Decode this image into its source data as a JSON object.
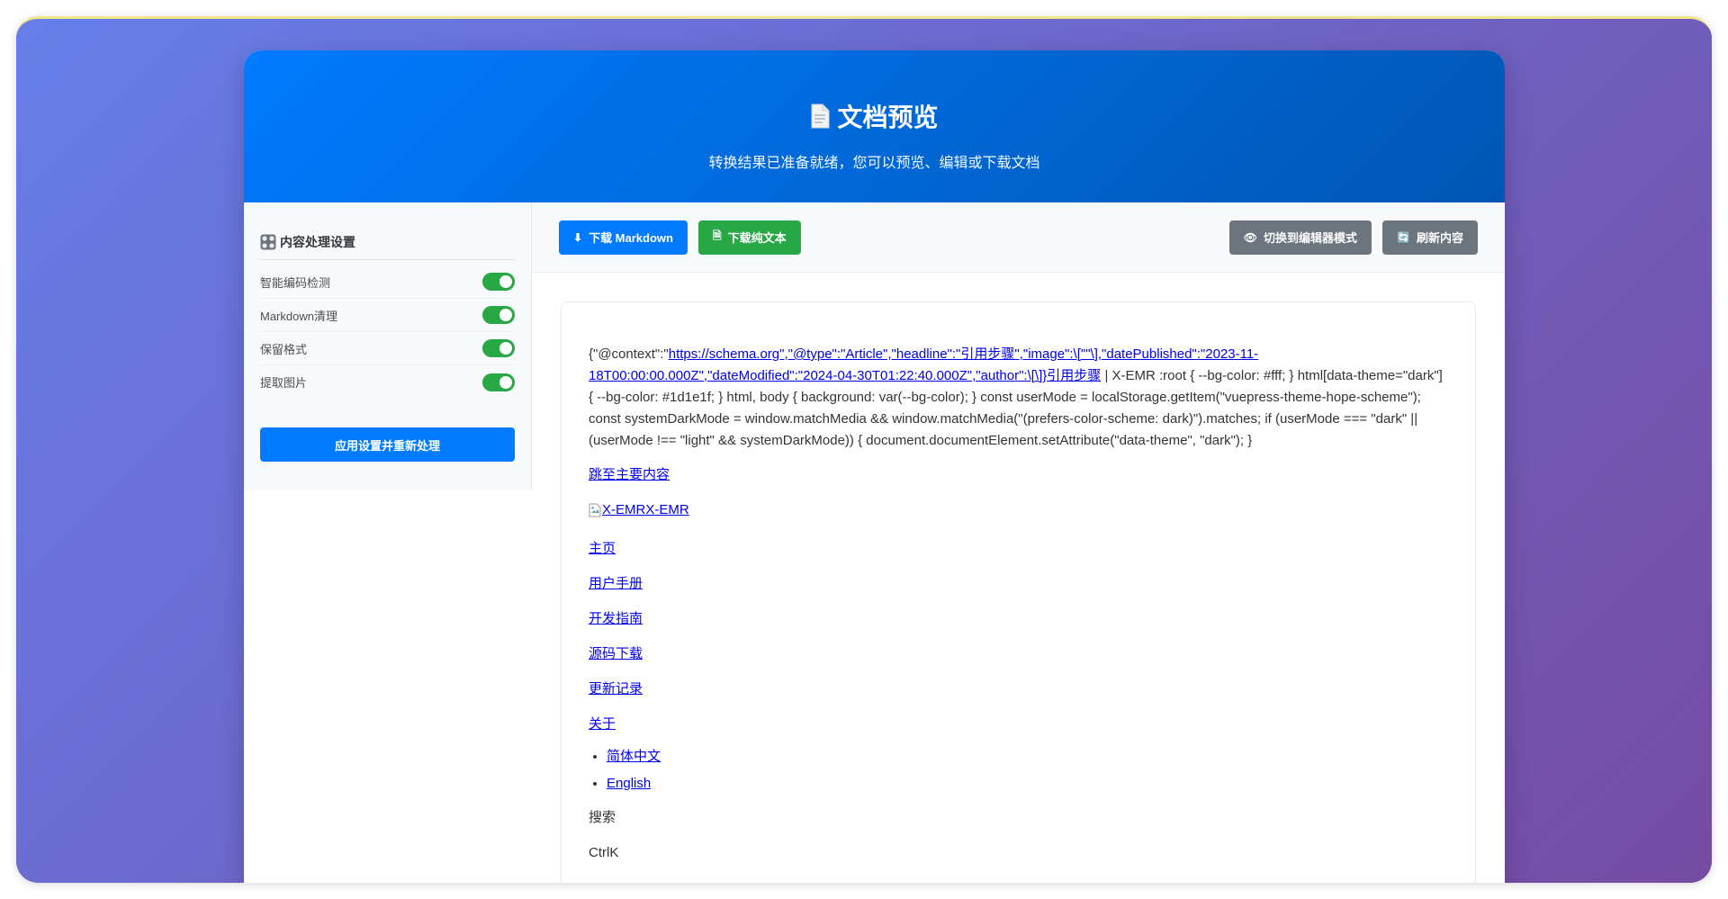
{
  "header": {
    "title": "文档预览",
    "subtitle": "转换结果已准备就绪，您可以预览、编辑或下载文档"
  },
  "sidebar": {
    "title": "内容处理设置",
    "settings": [
      {
        "label": "智能编码检测",
        "enabled": true
      },
      {
        "label": "Markdown清理",
        "enabled": true
      },
      {
        "label": "保留格式",
        "enabled": true
      },
      {
        "label": "提取图片",
        "enabled": true
      }
    ],
    "apply_label": "应用设置并重新处理"
  },
  "toolbar": {
    "download_md_label": "下载 Markdown",
    "download_txt_label": "下载纯文本",
    "editor_mode_label": "切换到编辑器模式",
    "refresh_label": "刷新内容"
  },
  "preview": {
    "json_prefix": "{\"@context\":\"",
    "json_link": "https://schema.org\",\"@type\":\"Article\",\"headline\":\"引用步骤\",\"image\":\\[\"\"\\],\"datePublished\":\"2023-11-18T00:00:00.000Z\",\"dateModified\":\"2024-04-30T01:22:40.000Z\",\"author\":\\[\\]}引用步骤",
    "json_rest": " | X-EMR :root { --bg-color: #fff; } html[data-theme=\"dark\"] { --bg-color: #1d1e1f; } html, body { background: var(--bg-color); } const userMode = localStorage.getItem(\"vuepress-theme-hope-scheme\"); const systemDarkMode = window.matchMedia && window.matchMedia(\"(prefers-color-scheme: dark)\").matches; if (userMode === \"dark\" || (userMode !== \"light\" && systemDarkMode)) { document.documentElement.setAttribute(\"data-theme\", \"dark\"); }",
    "skip_link": "跳至主要内容",
    "image_alt": "X-EMRX-EMR",
    "nav_links": [
      "主页",
      "用户手册",
      "开发指南",
      "源码下载",
      "更新记录",
      "关于"
    ],
    "lang_links": [
      "简体中文",
      "English"
    ],
    "search_text": "搜索",
    "shortcut_text": "CtrlK"
  },
  "colors": {
    "primary": "#007bff",
    "success": "#28a745",
    "secondary": "#6c757d",
    "gradient_start": "#667eea",
    "gradient_end": "#764ba2"
  }
}
